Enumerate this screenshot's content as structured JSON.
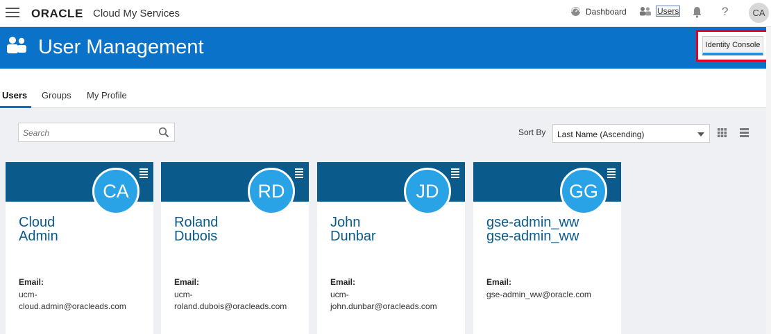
{
  "topbar": {
    "brand": "ORACLE",
    "product": "Cloud My Services",
    "dashboard_label": "Dashboard",
    "users_label": "Users",
    "avatar_initials": "CA"
  },
  "header": {
    "title": "User Management",
    "identity_console_label": "Identity Console",
    "highlight_color": "#e8001c"
  },
  "tabs": [
    {
      "label": "Users",
      "active": true
    },
    {
      "label": "Groups",
      "active": false
    },
    {
      "label": "My Profile",
      "active": false
    }
  ],
  "toolbar": {
    "search_placeholder": "Search",
    "sort_label": "Sort By",
    "sort_value": "Last Name (Ascending)"
  },
  "email_label": "Email:",
  "cards": [
    {
      "initials": "CA",
      "first": "Cloud",
      "last": "Admin",
      "email_line1": "ucm-",
      "email_line2": "cloud.admin@oracleads.com"
    },
    {
      "initials": "RD",
      "first": "Roland",
      "last": "Dubois",
      "email_line1": "ucm-",
      "email_line2": "roland.dubois@oracleads.com"
    },
    {
      "initials": "JD",
      "first": "John",
      "last": "Dunbar",
      "email_line1": "ucm-",
      "email_line2": "john.dunbar@oracleads.com"
    },
    {
      "initials": "GG",
      "first": "gse-admin_ww",
      "last": "gse-admin_ww",
      "email_line1": "gse-admin_ww@oracle.com",
      "email_line2": ""
    }
  ],
  "colors": {
    "header_blue": "#0a72c8",
    "card_band": "#0a5a8c",
    "avatar_blue": "#2aa3e6"
  }
}
